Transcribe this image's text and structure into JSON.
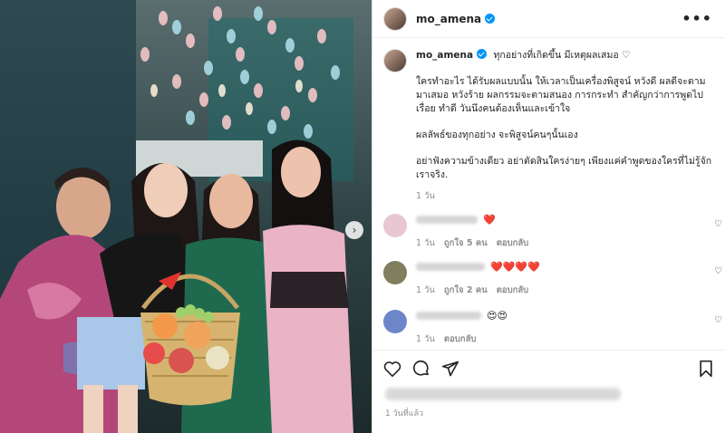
{
  "post": {
    "username": "mo_amena",
    "more_label": "•••",
    "caption_title": "ทุกอย่างที่เกิดขึ้น มีเหตุผลเสมอ ♡",
    "caption_p1": "ใครทำอะไร ได้รับผลแบบนั้น ให้เวลาเป็นเครื่องพิสูจน์ หวังดี ผลดีจะตามมาเสมอ หวังร้าย ผลกรรมจะตามสนอง การกระทำ สำคัญกว่าการพูดไปเรื่อย ทำดี วันนึงคนต้องเห็นและเข้าใจ",
    "caption_p2": "ผลลัพธ์ของทุกอย่าง จะพิสูจน์คนๆนั้นเอง",
    "caption_p3": "อย่าฟังความข้างเดียว อย่าตัดสินใครง่ายๆ เพียงแค่คำพูดของใครที่ไม่รู้จักเราจริง.",
    "caption_time": "1 วัน",
    "post_time": "1 วันที่แล้ว"
  },
  "comments": [
    {
      "emoji": "❤️",
      "time": "1 วัน",
      "likes": "ถูกใจ 5 คน",
      "reply": "ตอบกลับ",
      "avatar_color": "#e8c7d3"
    },
    {
      "emoji": "❤️❤️❤️❤️",
      "time": "1 วัน",
      "likes": "ถูกใจ 2 คน",
      "reply": "ตอบกลับ",
      "avatar_color": "#7f7f5f"
    },
    {
      "emoji": "😍😍",
      "time": "1 วัน",
      "likes": "",
      "reply": "ตอบกลับ",
      "avatar_color": "#6d86c9"
    }
  ],
  "colors": {
    "verified": "#0095f6",
    "secondary_text": "#8e8e8e"
  }
}
